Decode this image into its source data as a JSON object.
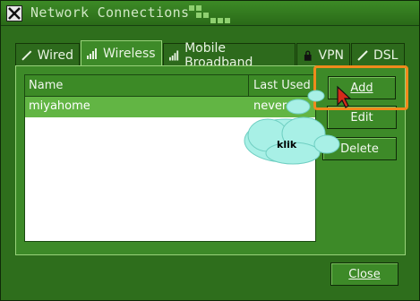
{
  "window": {
    "title": "Network Connections"
  },
  "tabs": [
    {
      "label": "Wired",
      "icon": "plug-icon",
      "active": false
    },
    {
      "label": "Wireless",
      "icon": "signal-bars-icon",
      "active": true
    },
    {
      "label": "Mobile Broadband",
      "icon": "signal-bars-icon",
      "active": false
    },
    {
      "label": "VPN",
      "icon": "lock-icon",
      "active": false
    },
    {
      "label": "DSL",
      "icon": "plug-icon",
      "active": false
    }
  ],
  "list": {
    "headers": {
      "name": "Name",
      "last_used": "Last Used"
    },
    "rows": [
      {
        "name": "miyahome",
        "last_used": "never",
        "selected": true
      }
    ]
  },
  "buttons": {
    "add": "Add",
    "edit": "Edit",
    "delete": "Delete",
    "close": "Close"
  },
  "annotation": {
    "callout_text": "klik",
    "highlight_color": "#f08a1c"
  },
  "colors": {
    "window_bg": "#2e6e1c",
    "selected_row": "#62b544",
    "accent": "#3c8a26"
  }
}
